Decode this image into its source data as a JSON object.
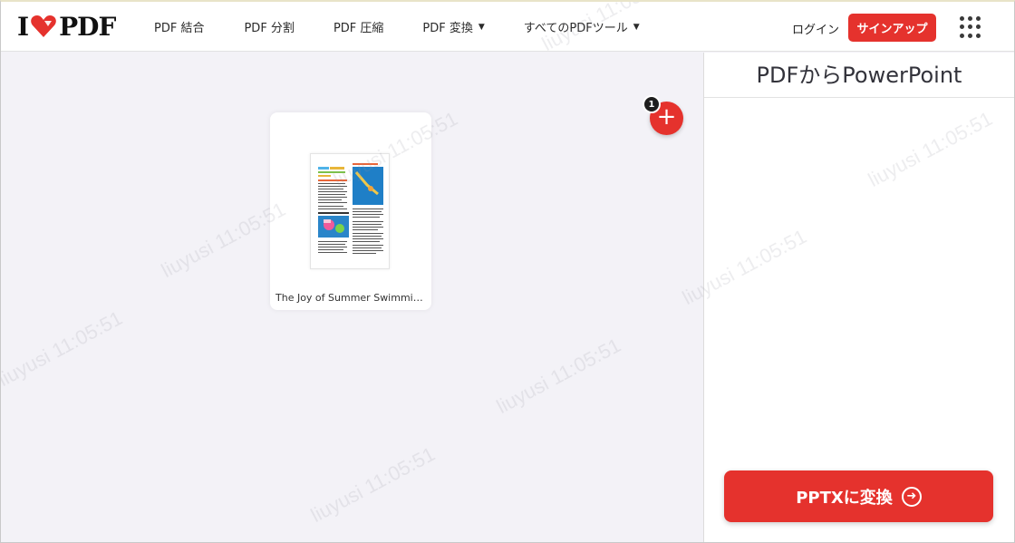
{
  "header": {
    "logo_left": "I",
    "logo_right": "PDF",
    "nav": [
      {
        "label": "PDF 結合",
        "dropdown": false
      },
      {
        "label": "PDF 分割",
        "dropdown": false
      },
      {
        "label": "PDF 圧縮",
        "dropdown": false
      },
      {
        "label": "PDF 変換",
        "dropdown": true
      },
      {
        "label": "すべてのPDFツール",
        "dropdown": true
      }
    ],
    "login_label": "ログイン",
    "signup_label": "サインアップ"
  },
  "workspace": {
    "file": {
      "name": "The Joy of Summer Swimming…"
    },
    "file_count": "1",
    "add_icon": "plus-icon"
  },
  "side_panel": {
    "title": "PDFからPowerPoint",
    "convert_label": "PPTXに変換",
    "convert_icon": "arrow-right-circle-icon"
  },
  "watermark": {
    "text": "liuyusi  11:05:51"
  },
  "colors": {
    "brand_red": "#e5322d",
    "background": "#f3f2f7"
  }
}
